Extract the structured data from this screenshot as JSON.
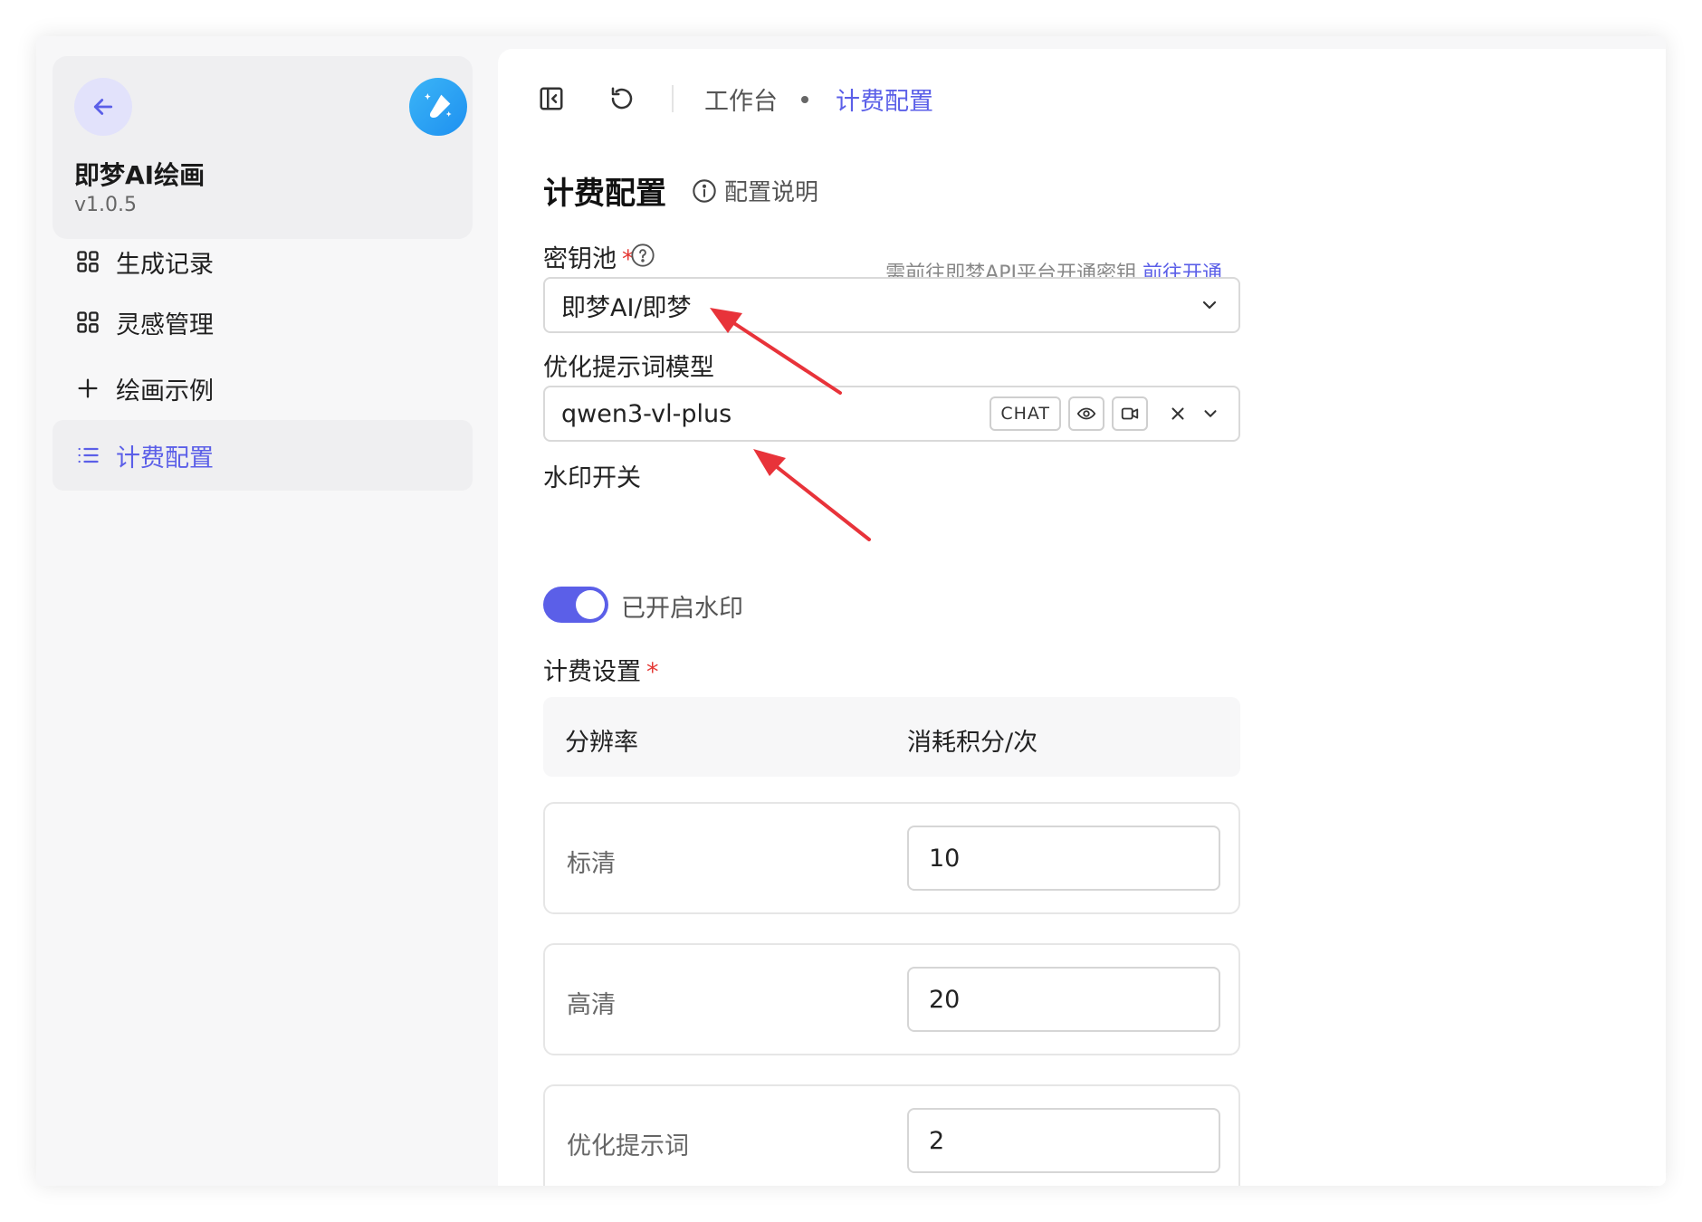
{
  "sidebar": {
    "app_title": "即梦AI绘画",
    "app_version": "v1.0.5",
    "items": [
      {
        "label": "生成记录",
        "icon": "grid-icon"
      },
      {
        "label": "灵感管理",
        "icon": "grid-icon"
      },
      {
        "label": "绘画示例",
        "icon": "plus-icon"
      },
      {
        "label": "计费配置",
        "icon": "list-icon",
        "active": true
      }
    ]
  },
  "breadcrumb": {
    "parent": "工作台",
    "current": "计费配置"
  },
  "page": {
    "title": "计费配置",
    "help_label": "配置说明"
  },
  "form": {
    "key_pool": {
      "label": "密钥池",
      "hint_text": "需前往即梦API平台开通密钥,",
      "hint_link": "前往开通",
      "value": "即梦AI/即梦"
    },
    "prompt_model": {
      "label": "优化提示词模型",
      "value": "qwen3-vl-plus",
      "tag": "CHAT"
    },
    "watermark": {
      "label": "水印开关",
      "status": "已开启水印",
      "enabled": true
    },
    "billing": {
      "label": "计费设置",
      "col_resolution": "分辨率",
      "col_cost": "消耗积分/次",
      "rows": [
        {
          "name": "标清",
          "value": "10"
        },
        {
          "name": "高清",
          "value": "20"
        },
        {
          "name": "优化提示词",
          "value": "2"
        }
      ]
    }
  },
  "colors": {
    "accent": "#5b5fe8",
    "required": "#e53935",
    "annotation_arrow": "#e8333a"
  }
}
